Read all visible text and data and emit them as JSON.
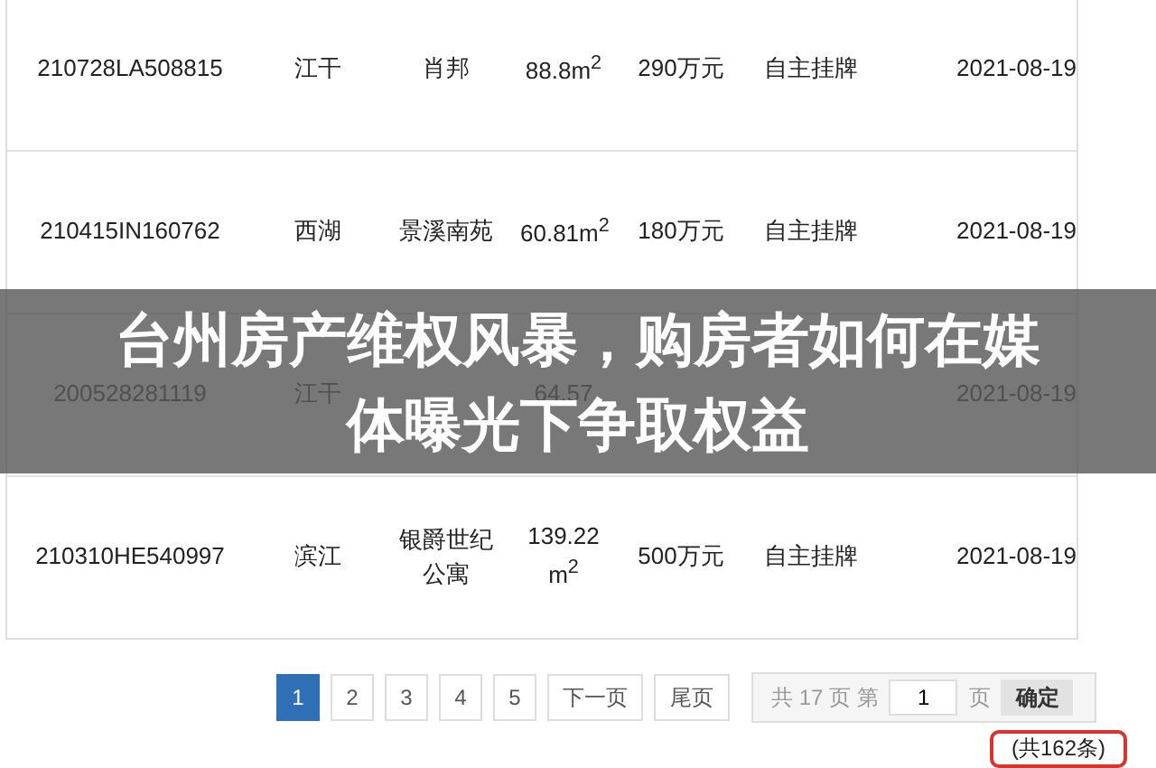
{
  "table": {
    "rows": [
      [
        "210728LA508815",
        "江干",
        "肖邦",
        "88.8m$^{2}$",
        "290万元",
        "自主挂牌",
        "2021-08-19"
      ],
      [
        "210415IN160762",
        "西湖",
        "景溪南苑",
        "60.81m$^{2}$",
        "180万元",
        "自主挂牌",
        "2021-08-19"
      ],
      [
        "200528281119",
        "江干",
        null,
        "64.57",
        null,
        null,
        "2021-08-19"
      ],
      [
        "210310HE540997",
        "滨江",
        "银爵世纪公寓",
        "139.22 m$^{2}$",
        "500万元",
        "自主挂牌",
        "2021-08-19"
      ]
    ]
  },
  "pagination": {
    "pages": [
      {
        "label": "1",
        "selected": true
      },
      {
        "label": "2",
        "selected": false
      },
      {
        "label": "3",
        "selected": false
      },
      {
        "label": "4",
        "selected": false
      },
      {
        "label": "5",
        "selected": false
      }
    ],
    "next": "下一页",
    "last": "尾页",
    "jump": {
      "prefix": "共 17 页 第",
      "value": "1",
      "suffix": "页",
      "button": "确定"
    },
    "total": {
      "text": "(共162条)",
      "circled": true
    }
  },
  "banner": {
    "headline_lines": [
      "台州房产维权风暴，购房者如何在媒",
      "体曝光下争取权益"
    ]
  }
}
